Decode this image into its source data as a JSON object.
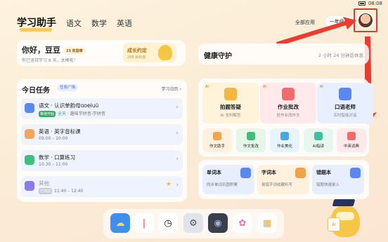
{
  "statusbar": {
    "time": "08:08",
    "battery_icon": "battery-icon"
  },
  "nav": {
    "active": "学习助手",
    "items": [
      "语文",
      "数学",
      "英语"
    ]
  },
  "header": {
    "all_apps": "全部应用",
    "grade": "一年级",
    "grade_arrow": "▾",
    "avatar_icon": "avatar-icon"
  },
  "greeting": {
    "title": "你好，豆豆",
    "badge": "23 枚勋章",
    "subtitle": "你已坚持学习 8 天，太棒啦！",
    "growth": {
      "title": "成长约定",
      "sub": "268 目标值"
    }
  },
  "health": {
    "title": "健康守护",
    "status": "2 小时 24 分钟后休息"
  },
  "tasks": {
    "title": "今日任务",
    "square_label": "任务广场",
    "calendar_label": "学习日历",
    "items": [
      {
        "title": "语文 · 认识单韵母ɑoeiuü",
        "tag": "等待开始",
        "time": "全天",
        "detail": " · 趣味学拼音-学拼音",
        "color": "#5b87f0",
        "starred": false
      },
      {
        "title": "英语 · 英字音标课",
        "tag": "",
        "time": "09:00 – 10:00",
        "detail": "",
        "color": "#f6a65a",
        "starred": false
      },
      {
        "title": "数学 · 口算练习",
        "tag": "",
        "time": "10:30 – 11:00",
        "detail": "",
        "color": "#3fbf7c",
        "starred": false
      },
      {
        "title": "其他",
        "tag": "已完成",
        "time": "11:40 – 12:40",
        "detail": "",
        "color": "#8a7be8",
        "starred": true
      }
    ]
  },
  "tools": {
    "big": [
      {
        "title": "拍题答疑",
        "sub": "AI 全科解答",
        "ai": "AI",
        "bg": "#fff3da",
        "icon": "#f8b540"
      },
      {
        "title": "作业批改",
        "sub": "批作业改作文",
        "ai": "AI",
        "bg": "#ffe9ea",
        "icon": "#f46a6a"
      },
      {
        "title": "口语老师",
        "sub": "实时智能对话",
        "ai": "AI",
        "bg": "#e8efff",
        "icon": "#5b87f0"
      }
    ],
    "small": [
      {
        "label": "作文助手",
        "bg": "#fff1dd",
        "icon": "#f4a24a"
      },
      {
        "label": "作文批改",
        "bg": "#e6f7ea",
        "icon": "#3fbf7c"
      },
      {
        "label": "作业美化",
        "bg": "#e8f4fd",
        "icon": "#4aa8e0"
      },
      {
        "label": "AI指读",
        "bg": "#e7f7f0",
        "icon": "#3fbf9c"
      },
      {
        "label": "中英词典",
        "bg": "#ffe9ea",
        "icon": "#f46a6a"
      }
    ]
  },
  "words": [
    {
      "title": "单词本",
      "sub": "同步单词巩固积累",
      "bg": "#e8efff",
      "icon": "#5b87f0"
    },
    {
      "title": "字词本",
      "sub": "易错字词收藏听写",
      "bg": "#fff1dd",
      "icon": "#f4a24a"
    },
    {
      "title": "错题本",
      "sub": "错题快速录入",
      "bg": "#e8efff",
      "icon": "#5b87f0"
    }
  ],
  "dock": [
    {
      "name": "weather-app-icon",
      "bg": "#3f8ff0",
      "glyph": "☁"
    },
    {
      "name": "recorder-app-icon",
      "bg": "#ffffff",
      "glyph": "|"
    },
    {
      "name": "clock-app-icon",
      "bg": "#ffffff",
      "glyph": "◷"
    },
    {
      "name": "settings-app-icon",
      "bg": "#dfe3ea",
      "glyph": "⚙"
    },
    {
      "name": "camera-app-icon",
      "bg": "#3a3f4c",
      "glyph": "◉"
    },
    {
      "name": "photos-app-icon",
      "bg": "#ffffff",
      "glyph": "✿"
    },
    {
      "name": "apps-folder-icon",
      "bg": "#ffffff",
      "glyph": "▦"
    }
  ],
  "mascot": {
    "sign": "AI"
  },
  "colors": {
    "highlight": "#e8382c",
    "accent": "#f5b93a"
  }
}
